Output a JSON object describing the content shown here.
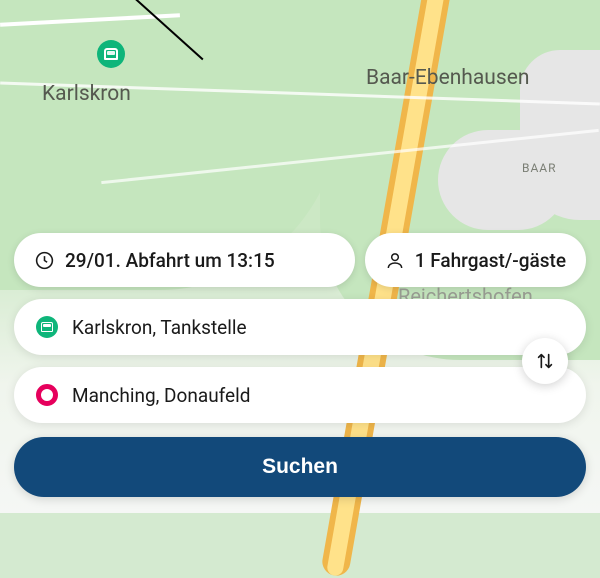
{
  "map": {
    "labels": {
      "karlskron": "Karlskron",
      "baar": "Baar-Ebenhausen",
      "baar_small": "BAAR",
      "reichertshofen": "Reichertshofen"
    }
  },
  "search": {
    "time_label": "29/01. Abfahrt um 13:15",
    "passengers_label": "1 Fahrgast/-gäste",
    "origin": "Karlskron, Tankstelle",
    "destination": "Manching, Donaufeld",
    "button": "Suchen"
  },
  "colors": {
    "primary": "#12497a",
    "origin_marker": "#0eb57a",
    "destination_marker": "#e6005c"
  }
}
